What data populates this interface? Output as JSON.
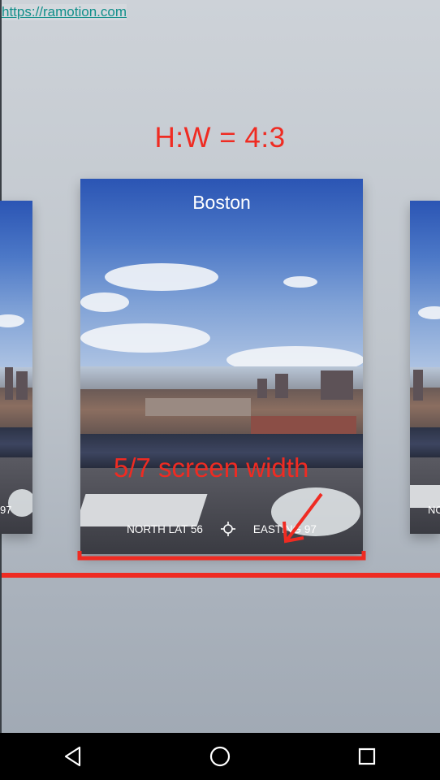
{
  "link": {
    "url_text": "https://ramotion.com"
  },
  "annotations": {
    "aspect_ratio": "H:W = 4:3",
    "width_note": "5/7 screen width",
    "color": "#ef2b22"
  },
  "cards": {
    "main": {
      "title": "Boston",
      "north_label": "NORTH LAT 56",
      "east_label": "EASTING 97",
      "center_icon": "crosshair-icon"
    },
    "left_peek": {
      "label": "97"
    },
    "right_peek": {
      "label": "NO"
    }
  },
  "navbar": {
    "back_icon": "back-triangle-icon",
    "home_icon": "home-circle-icon",
    "recents_icon": "recents-square-icon"
  }
}
